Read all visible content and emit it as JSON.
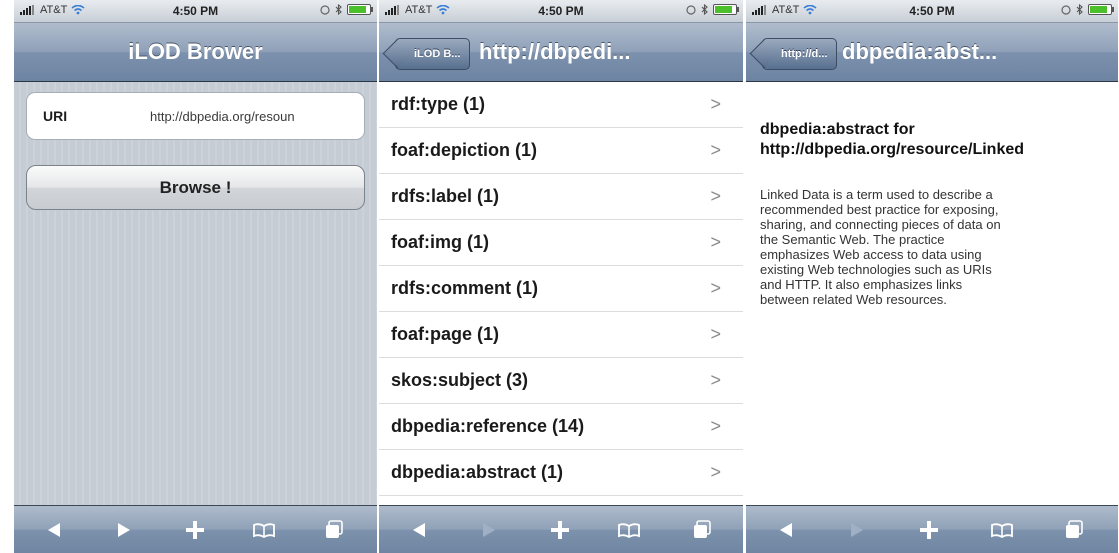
{
  "status": {
    "carrier": "AT&T",
    "time": "4:50 PM"
  },
  "screen1": {
    "title": "iLOD Brower",
    "uri_label": "URI",
    "uri_value": "http://dbpedia.org/resoun",
    "browse_label": "Browse !"
  },
  "screen2": {
    "back_label": "iLOD B...",
    "title": "http://dbpedi...",
    "rows": [
      {
        "label": "rdf:type (1)",
        "chevron": ">"
      },
      {
        "label": "foaf:depiction (1)",
        "chevron": ">"
      },
      {
        "label": "rdfs:label (1)",
        "chevron": ">"
      },
      {
        "label": "foaf:img (1)",
        "chevron": ">"
      },
      {
        "label": "rdfs:comment (1)",
        "chevron": ">"
      },
      {
        "label": "foaf:page (1)",
        "chevron": ">"
      },
      {
        "label": "skos:subject (3)",
        "chevron": ">"
      },
      {
        "label": "dbpedia:reference (14)",
        "chevron": ">"
      },
      {
        "label": "dbpedia:abstract (1)",
        "chevron": ">"
      }
    ]
  },
  "screen3": {
    "back_label": "http://d...",
    "title": "dbpedia:abst...",
    "heading_line1": "dbpedia:abstract for",
    "heading_line2": "http://dbpedia.org/resource/Linked",
    "body_lines": [
      "Linked Data is a term used to describe a",
      "recommended best practice for exposing,",
      "sharing, and connecting pieces of data on",
      "the Semantic Web. The practice",
      "emphasizes Web access to data using",
      "existing Web technologies such as URIs",
      "and HTTP. It also emphasizes links",
      "between related Web resources."
    ]
  },
  "toolbar": {
    "icons": [
      "back-arrow-icon",
      "forward-arrow-icon",
      "add-icon",
      "bookmarks-icon",
      "pages-icon"
    ],
    "pages_count": "2"
  },
  "colors": {
    "nav_blue": "#6d84a2",
    "stripe_bg": "#c5ccd4",
    "battery_green": "#4cc02a"
  }
}
